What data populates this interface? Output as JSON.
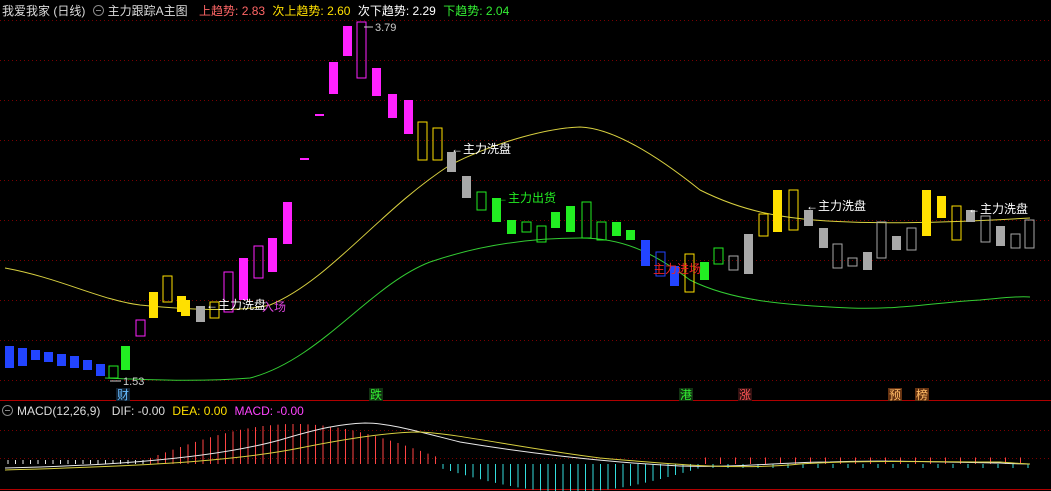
{
  "header": {
    "stock": "我爱我家 (日线)",
    "indicator": "主力跟踪A主图",
    "up_label": "上趋势:",
    "up_value": "2.83",
    "subup_label": "次上趋势:",
    "subup_value": "2.60",
    "subdown_label": "次下趋势:",
    "subdown_value": "2.29",
    "down_label": "下趋势:",
    "down_value": "2.04"
  },
  "macd_header": {
    "title": "MACD(12,26,9)",
    "dif": "DIF: -0.00",
    "dea": "DEA: 0.00",
    "macd": "MACD: -0.00"
  },
  "colors": {
    "magenta": "#ff22ff",
    "yellow": "#ffe000",
    "green": "#22ee22",
    "blue": "#2244ff",
    "gray": "#a8a8a8",
    "up_line": "#d8d040",
    "low_line": "#33cc33",
    "grid": "#7a0000"
  },
  "chart_data": {
    "type": "candlestick",
    "price_high_label": "3.79",
    "price_low_label": "1.53",
    "annotations": [
      "主力洗盘",
      "主力洗盘",
      "主力洗盘",
      "主力洗盘",
      "主力出货",
      "主力进场",
      "入场"
    ],
    "markers": [
      "财",
      "跌",
      "港",
      "涨",
      "预",
      "榜"
    ]
  }
}
